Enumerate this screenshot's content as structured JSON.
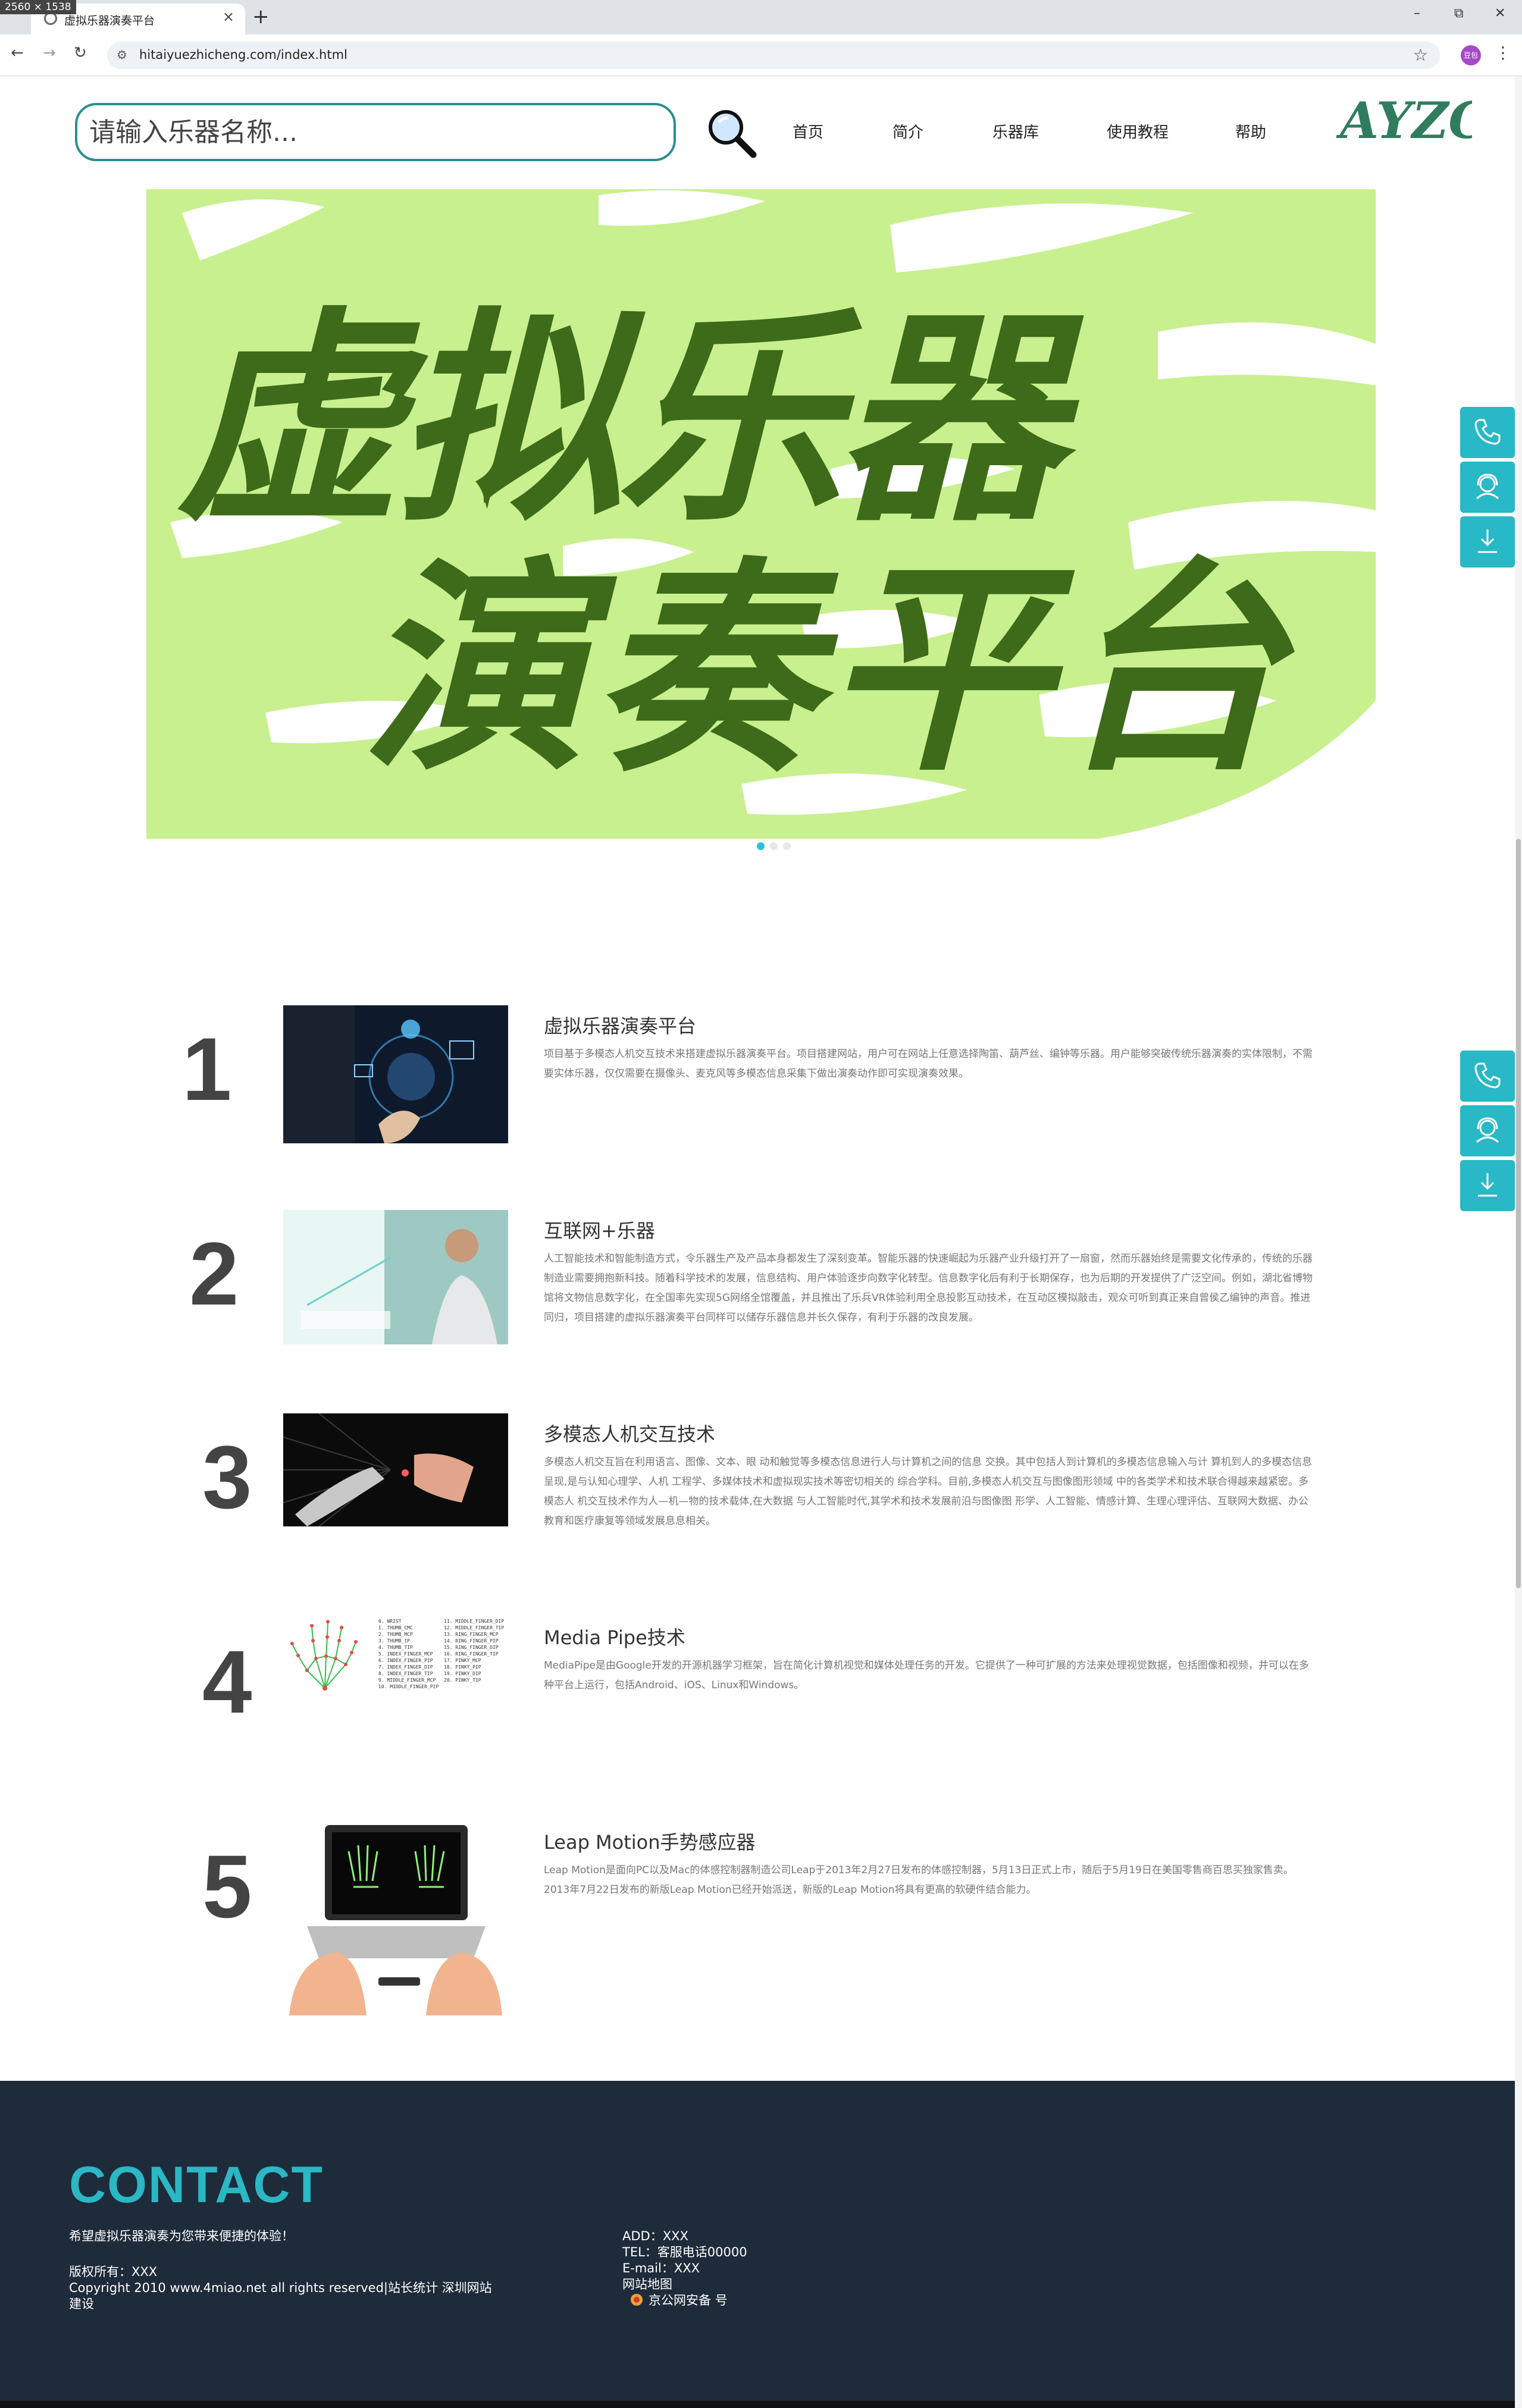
{
  "screenshot_badge": "2560 × 1538",
  "browser": {
    "tab_title": "虚拟乐器演奏平台",
    "tab_close": "×",
    "new_tab": "+",
    "window": {
      "minimize": "–",
      "restore": "⧉",
      "close": "✕"
    },
    "back": "←",
    "forward": "→",
    "reload": "↻",
    "url": "hitaiyuezhicheng.com/index.html",
    "profile_label": "豆包",
    "bookmark_icon": "☆",
    "menu_icon": "⋮"
  },
  "header": {
    "search_placeholder": "请输入乐器名称...",
    "nav": [
      "首页",
      "简介",
      "乐器库",
      "使用教程",
      "帮助"
    ],
    "logo_text": "AYZC"
  },
  "hero": {
    "line1": "虚拟乐器",
    "line2": "演奏平台",
    "bg_color": "#c8f08e",
    "ink_color": "#3d6b1a",
    "active_dot_color": "#28c4d4"
  },
  "features": [
    {
      "num": "1",
      "title": "虚拟乐器演奏平台",
      "desc": "项目基于多模态人机交互技术来搭建虚拟乐器演奏平台。项目搭建网站，用户可在网站上任意选择陶笛、葫芦丝、编钟等乐器。用户能够突破传统乐器演奏的实体限制，不需要实体乐器，仅仅需要在摄像头、麦克风等多模态信息采集下做出演奏动作即可实现演奏效果。"
    },
    {
      "num": "2",
      "title": "互联网+乐器",
      "desc": "人工智能技术和智能制造方式，令乐器生产及产品本身都发生了深刻变革。智能乐器的快速崛起为乐器产业升级打开了一扇窗，然而乐器始终是需要文化传承的，传统的乐器制造业需要拥抱新科技。随着科学技术的发展，信息结构、用户体验逐步向数字化转型。信息数字化后有利于长期保存，也为后期的开发提供了广泛空间。例如，湖北省博物馆将文物信息数字化，在全国率先实现5G网络全馆覆盖，并且推出了乐兵VR体验利用全息投影互动技术，在互动区模拟敲击，观众可听到真正来自曾侯乙编钟的声音。推进同归，项目搭建的虚拟乐器演奏平台同样可以储存乐器信息并长久保存，有利于乐器的改良发展。"
    },
    {
      "num": "3",
      "title": "多模态人机交互技术",
      "desc": "多模态人机交互旨在利用语言、图像、文本、眼 动和触觉等多模态信息进行人与计算机之间的信息 交换。其中包括人到计算机的多模态信息输入与计 算机到人的多模态信息呈现,是与认知心理学、人机 工程学、多媒体技术和虚拟现实技术等密切相关的 综合学科。目前,多模态人机交互与图像图形领域 中的各类学术和技术联合得越来越紧密。多模态人 机交互技术作为人—机—物的技术载体,在大数据 与人工智能时代,其学术和技术发展前沿与图像图 形学、人工智能、情感计算、生理心理评估、互联网大数据、办公教育和医疗康复等领域发展息息相关。"
    },
    {
      "num": "4",
      "title": "Media Pipe技术",
      "desc": "MediaPipe是由Google开发的开源机器学习框架，旨在简化计算机视觉和媒体处理任务的开发。它提供了一种可扩展的方法来处理视觉数据，包括图像和视频，并可以在多种平台上运行，包括Android、iOS、Linux和Windows。",
      "landmarks_left": [
        "0. WRIST",
        "1. THUMB_CMC",
        "2. THUMB_MCP",
        "3. THUMB_IP",
        "4. THUMB_TIP",
        "5. INDEX_FINGER_MCP",
        "6. INDEX_FINGER_PIP",
        "7. INDEX_FINGER_DIP",
        "8. INDEX_FINGER_TIP",
        "9. MIDDLE_FINGER_MCP",
        "10. MIDDLE_FINGER_PIP"
      ],
      "landmarks_right": [
        "11. MIDDLE_FINGER_DIP",
        "12. MIDDLE_FINGER_TIP",
        "13. RING_FINGER_MCP",
        "14. RING_FINGER_PIP",
        "15. RING_FINGER_DIP",
        "16. RING_FINGER_TIP",
        "17. PINKY_MCP",
        "18. PINKY_PIP",
        "19. PINKY_DIP",
        "20. PINKY_TIP"
      ]
    },
    {
      "num": "5",
      "title": "Leap Motion手势感应器",
      "desc": "Leap Motion是面向PC以及Mac的体感控制器制造公司Leap于2013年2月27日发布的体感控制器，5月13日正式上市，随后于5月19日在美国零售商百思买独家售卖。2013年7月22日发布的新版Leap Motion已经开始派送，新版的Leap Motion将具有更高的软硬件结合能力。"
    }
  ],
  "footer": {
    "heading": "CONTACT",
    "slogan": "希望虚拟乐器演奏为您带来便捷的体验！",
    "copyright_owner": "版权所有：XXX",
    "copyright_line": "Copyright 2010 www.4miao.net all rights reserved|站长统计 深圳网站",
    "copyright_tail": "建设",
    "add": "ADD：XXX",
    "tel": "TEL：客服电话00000",
    "email": "E-mail：XXX",
    "sitemap": "网站地图",
    "police": "京公网安备 号",
    "bg_color": "#1e2b3a",
    "accent": "#2bb7c4"
  },
  "side_float": [
    "phone-icon",
    "customer-service-icon",
    "download-icon"
  ]
}
